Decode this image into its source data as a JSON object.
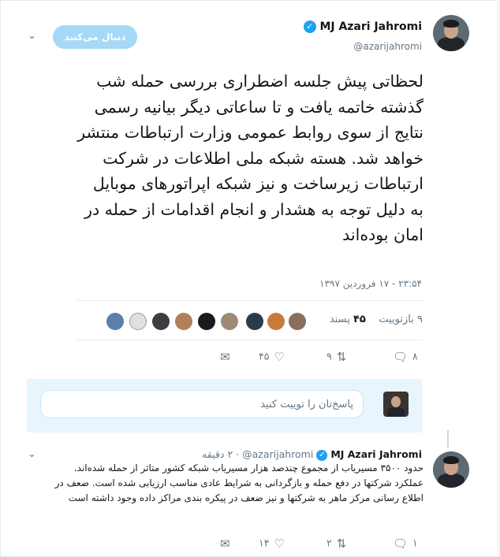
{
  "tweet": {
    "author_name": "MJ Azari Jahromi",
    "handle": "@azarijahromi",
    "follow_label": "دنبال می‌کنید",
    "text": "لحظاتی پیش جلسه اضطراری بررسی حمله شب گذشته خاتمه یافت و تا ساعاتی دیگر بیانیه رسمی نتایج از سوی روابط عمومی وزارت ارتباطات منتشر خواهد شد. هسته شبکه ملی اطلاعات در شرکت ارتباطات زیرساخت و نیز شبکه اپراتورهای موبایل به دلیل توجه به هشدار و انجام اقدامات از حمله در امان بوده‌اند",
    "timestamp": "۲۳:۵۴ - ۱۷ فروردین ۱۳۹۷",
    "retweets_label": "۹ بازتوییت",
    "likes_count": "۴۵",
    "likes_label": "پسند",
    "reply_count": "۸",
    "retweet_count": "۹",
    "like_count": "۴۵"
  },
  "likers": [
    "avatar-1",
    "avatar-2",
    "avatar-3",
    "avatar-4",
    "avatar-5",
    "avatar-6",
    "avatar-7",
    "avatar-8",
    "avatar-9",
    "avatar-10"
  ],
  "reply_box": {
    "placeholder": "پاسخ‌تان را توییت کنید"
  },
  "reply": {
    "author_name": "MJ Azari Jahromi",
    "handle": "@azarijahromi",
    "time": "۲ دقیقه",
    "text": "حدود ۳۵۰۰ مسیریاب از مجموع چندصد هزار مسیریاب شبکه کشور متاثر از حمله شده‌اند. عملکرد شرکتها در دفع حمله و بازگردانی به شرایط عادی مناسب ارزیابی شده است. ضعف در اطلاع رسانی مرکز ماهر به شرکتها و نیز ضعف در پیکره بندی مراکز داده وجود داشته است",
    "reply_count": "۱",
    "retweet_count": "۲",
    "like_count": "۱۴"
  },
  "colors": {
    "accent": "#1da1f2",
    "follow_button": "#a6d8f7",
    "muted_text": "#657786",
    "reply_area": "#e8f5fd"
  }
}
